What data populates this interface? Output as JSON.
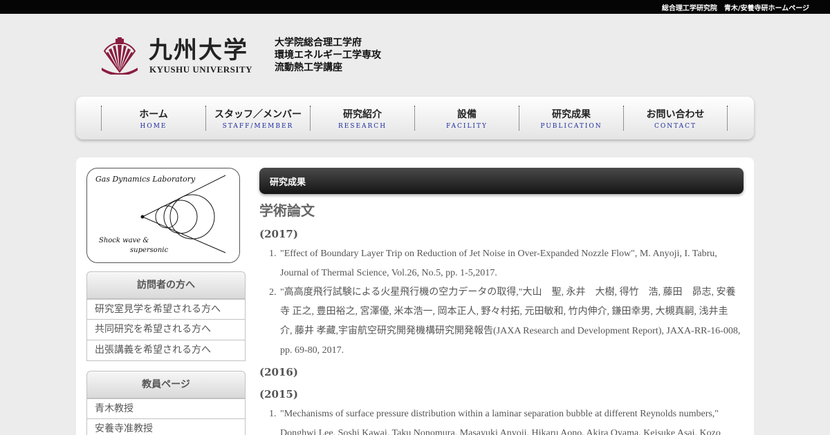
{
  "topbar": {
    "text": "総合理工学研究院　青木/安養寺研ホームページ"
  },
  "header": {
    "logo_kanji": "九州大学",
    "logo_en": "KYUSHU UNIVERSITY",
    "dept_lines": [
      "大学院総合理工学府",
      "環境エネルギー工学専攻",
      "流動熱工学講座"
    ]
  },
  "nav": {
    "items": [
      {
        "ja": "ホーム",
        "en": "HOME"
      },
      {
        "ja": "スタッフ／メンバー",
        "en": "STAFF/MEMBER"
      },
      {
        "ja": "研究紹介",
        "en": "RESEARCH"
      },
      {
        "ja": "設備",
        "en": "FACILITY"
      },
      {
        "ja": "研究成果",
        "en": "PUBLICATION"
      },
      {
        "ja": "お問い合わせ",
        "en": "CONTACT"
      }
    ]
  },
  "lab_logo": {
    "title": "Gas Dynamics Laboratory",
    "sub1": "Shock wave &",
    "sub2": "supersonic"
  },
  "sidebar": {
    "visitors": {
      "heading": "訪問者の方へ",
      "items": [
        "研究室見学を希望される方へ",
        "共同研究を希望される方へ",
        "出張講義を希望される方へ"
      ]
    },
    "faculty": {
      "heading": "教員ページ",
      "items": [
        "青木教授",
        "安養寺准教授"
      ]
    }
  },
  "main": {
    "section_title": "研究成果",
    "heading": "学術論文",
    "years": [
      "(2017)",
      "(2016)",
      "(2015)"
    ],
    "pubs_2017": [
      {
        "num": "1.",
        "lines": [
          "\"Effect of Boundary Layer Trip on Reduction of Jet Noise in Over-Expanded Nozzle Flow\", M. Anyoji, I. Tabru,",
          "Journal of Thermal Science, Vol.26, No.5, pp. 1-5,2017."
        ]
      },
      {
        "num": "2.",
        "lines": [
          "\"高高度飛行試験による火星飛行機の空力データの取得,\"大山　聖, 永井　大樹, 得竹　浩, 藤田　昴志, 安養",
          "寺 正之, 豊田裕之, 宮澤優, 米本浩一, 岡本正人, 野々村拓, 元田敏和, 竹内伸介, 鎌田幸男, 大槻真嗣, 浅井圭",
          "介, 藤井 孝藏,宇宙航空研究開発機構研究開発報告(JAXA Research and Development Report), JAXA-RR-16-008,",
          "pp. 69-80, 2017."
        ]
      }
    ],
    "pubs_2015": [
      {
        "num": "1.",
        "lines": [
          "\"Mechanisms of surface pressure distribution within a laminar separation bubble at different Reynolds numbers,\"",
          "Donghwi Lee, Soshi Kawai, Taku Nonomura, Masayuki Anyoji, Hikaru Aono, Akira Oyama, Keisuke Asai, Kozo"
        ]
      }
    ]
  },
  "colors": {
    "nav_en": "#1c2b9e",
    "emblem": "#8a1d3f",
    "topbar": "#050505"
  }
}
